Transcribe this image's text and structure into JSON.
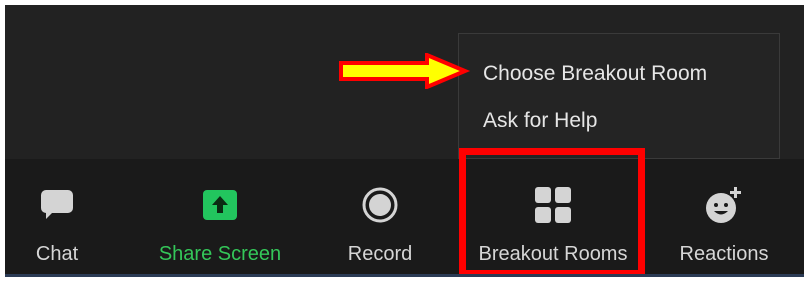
{
  "menu": {
    "items": [
      {
        "label": "Choose Breakout Room"
      },
      {
        "label": "Ask for Help"
      }
    ]
  },
  "toolbar": {
    "items": [
      {
        "label": "Chat",
        "icon": "chat-bubble-icon"
      },
      {
        "label": "Share Screen",
        "icon": "share-screen-arrow-icon",
        "accent": "#34c759"
      },
      {
        "label": "Record",
        "icon": "record-icon"
      },
      {
        "label": "Breakout Rooms",
        "icon": "breakout-rooms-grid-icon"
      },
      {
        "label": "Reactions",
        "icon": "reactions-emoji-icon"
      }
    ]
  },
  "annotations": {
    "arrow_color": "#ffff00",
    "arrow_outline": "#ff0000",
    "highlight_color": "#ff0000"
  }
}
